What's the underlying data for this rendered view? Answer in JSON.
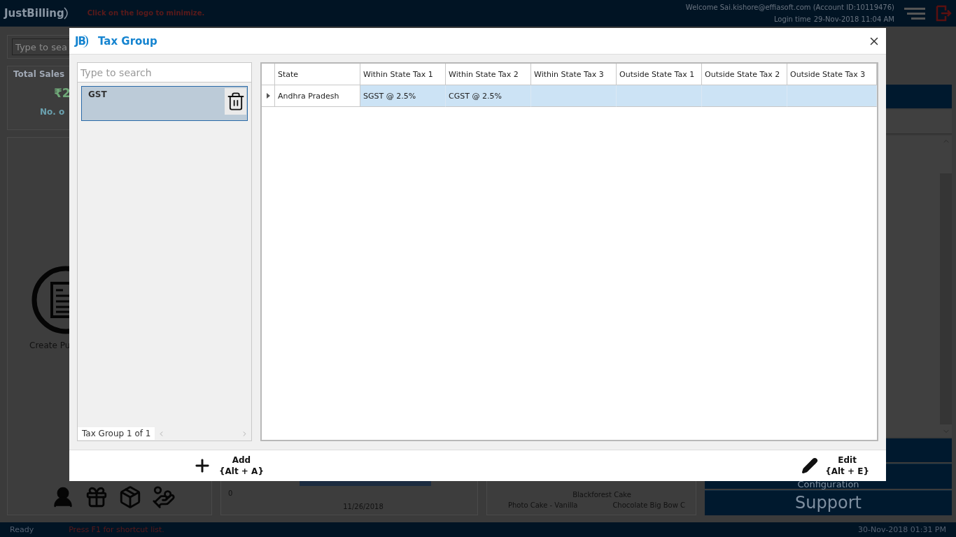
{
  "app": {
    "logo": "JustBilling",
    "hint": "Click on the logo to minimize.",
    "welcome": "Welcome Sai.kishore@effiasoft.com (Account ID:10119476)",
    "login_label": "Login time",
    "login_time": "29-Nov-2018 11:04 AM"
  },
  "background": {
    "search_placeholder": "Type to sea",
    "total_sales_title": "Total Sales",
    "total_sales_value": "₹2",
    "count_label": "No. o",
    "create_label": "Create Pu",
    "chart_axis": "0",
    "chart_date": "11/26/2018",
    "products": [
      "Blackforest Cake",
      "Photo Cake - Vanilla",
      "Chocolate Big Bow C"
    ],
    "menu": [
      "Configuration",
      "Support"
    ]
  },
  "dialog": {
    "logo_text": "JB",
    "title": "Tax Group",
    "search_placeholder": "Type to search",
    "groups": [
      {
        "name": "GST",
        "selected": true
      }
    ],
    "pager": "Tax Group 1 of 1",
    "columns": [
      "State",
      "Within State Tax 1",
      "Within State Tax 2",
      "Within State Tax 3",
      "Outside State Tax 1",
      "Outside State Tax 2",
      "Outside State Tax 3"
    ],
    "rows": [
      {
        "selected": true,
        "cells": [
          "Andhra Pradesh",
          "SGST @ 2.5%",
          "CGST @ 2.5%"
        ]
      }
    ],
    "buttons": [
      {
        "kind": "add",
        "label": "Add",
        "shortcut": "{Alt + A}"
      },
      {
        "kind": "edit",
        "label": "Edit",
        "shortcut": "{Alt + E}"
      }
    ]
  },
  "status_bar": {
    "state": "Ready",
    "hint": "Press F1 for shortcut list.",
    "datetime": "30-Nov-2018 01:31 PM"
  }
}
